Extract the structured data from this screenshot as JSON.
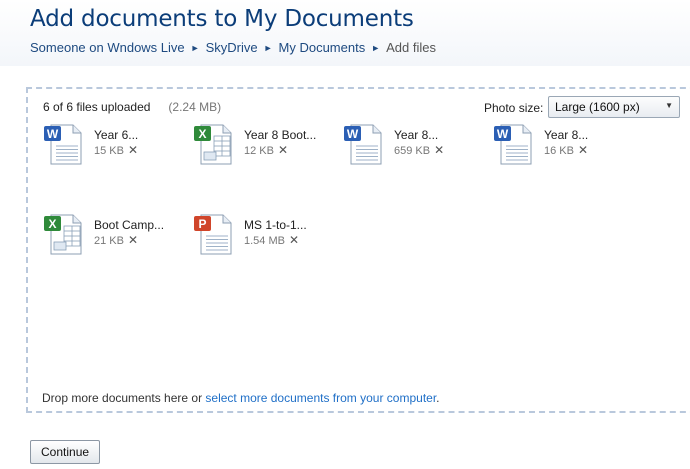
{
  "header": {
    "title": "Add documents to My Documents",
    "breadcrumb": [
      "Someone on Wndows Live",
      "SkyDrive",
      "My Documents",
      "Add files"
    ],
    "separator": "►"
  },
  "upload": {
    "status": "6 of 6 files uploaded",
    "total_size": "(2.24 MB)",
    "photo_size_label": "Photo size:",
    "photo_size_value": "Large (1600 px)"
  },
  "files": [
    {
      "name": "Year 6...",
      "size": "15 KB",
      "type": "word",
      "letter": "W",
      "color": "#2b5fb4"
    },
    {
      "name": "Year 8 Boot...",
      "size": "12 KB",
      "type": "excel",
      "letter": "X",
      "color": "#2f8a3a"
    },
    {
      "name": "Year 8...",
      "size": "659 KB",
      "type": "word",
      "letter": "W",
      "color": "#2b5fb4"
    },
    {
      "name": "Year 8...",
      "size": "16 KB",
      "type": "word",
      "letter": "W",
      "color": "#2b5fb4"
    },
    {
      "name": "Boot Camp...",
      "size": "21 KB",
      "type": "excel",
      "letter": "X",
      "color": "#2f8a3a"
    },
    {
      "name": "MS 1-to-1...",
      "size": "1.54 MB",
      "type": "powerpoint",
      "letter": "P",
      "color": "#d0452a"
    }
  ],
  "remove_glyph": "✕",
  "drop_hint": {
    "text": "Drop more documents here or ",
    "link": "select more documents from your computer",
    "suffix": "."
  },
  "actions": {
    "continue_label": "Continue"
  }
}
